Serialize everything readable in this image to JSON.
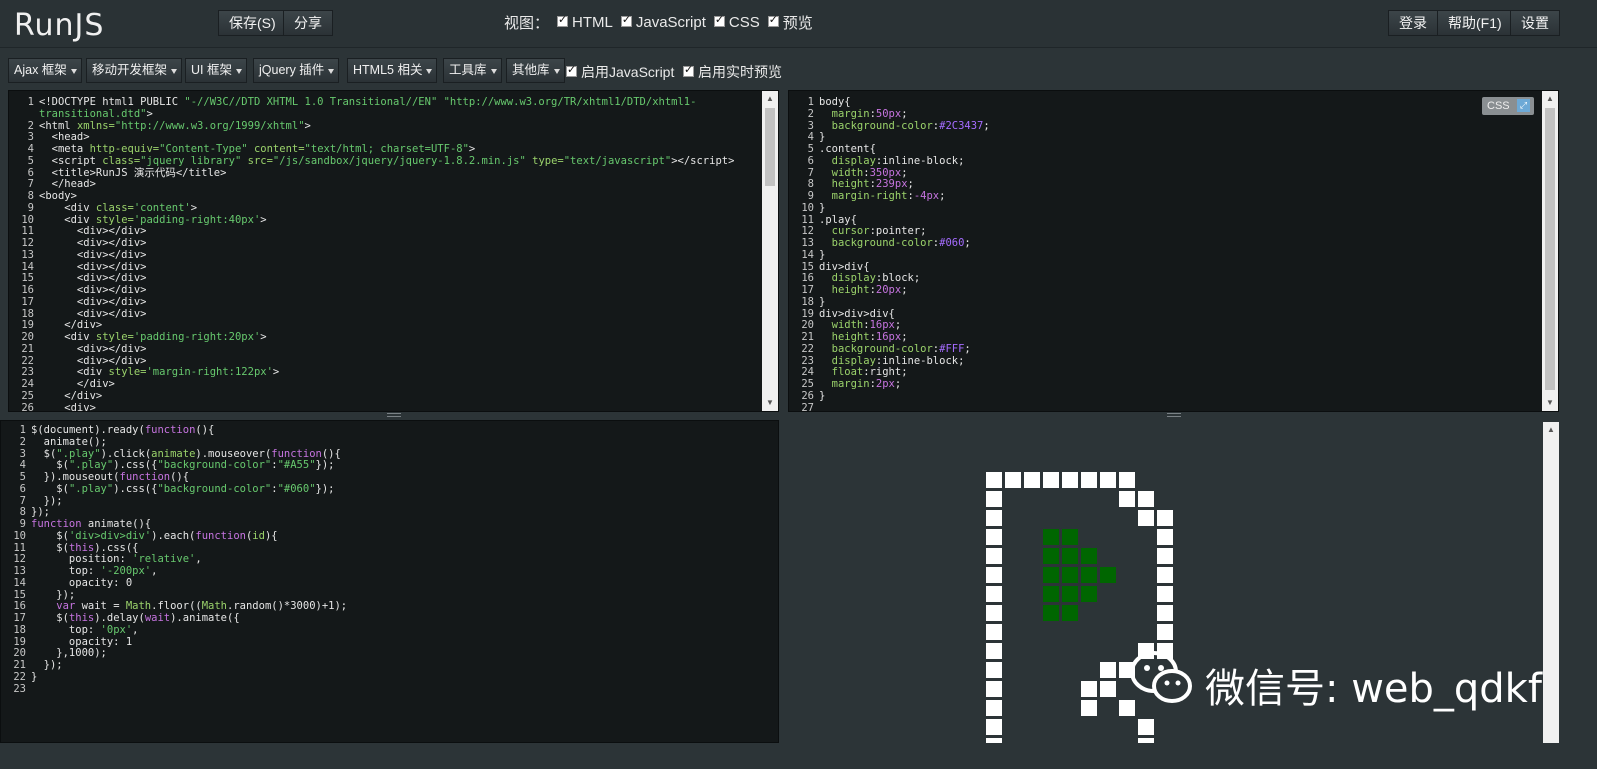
{
  "app": {
    "logo": "RunJS"
  },
  "topbar": {
    "save_label": "保存(S)",
    "share_label": "分享",
    "view_label": "视图：",
    "view_options": [
      "HTML",
      "JavaScript",
      "CSS",
      "预览"
    ],
    "login_label": "登录",
    "help_label": "帮助(F1)",
    "settings_label": "设置"
  },
  "toolbar": {
    "libs": [
      "Ajax 框架",
      "移动开发框架",
      "UI 框架",
      "jQuery 插件",
      "HTML5 相关",
      "工具库",
      "其他库"
    ],
    "enable_js": "启用JavaScript",
    "enable_live": "启用实时预览"
  },
  "css_panel": {
    "badge": "CSS"
  },
  "watermark": "微信号: web_qdkf",
  "colors": {
    "background": "#2C3437",
    "play": "#006600",
    "block": "#FFFFFF"
  }
}
